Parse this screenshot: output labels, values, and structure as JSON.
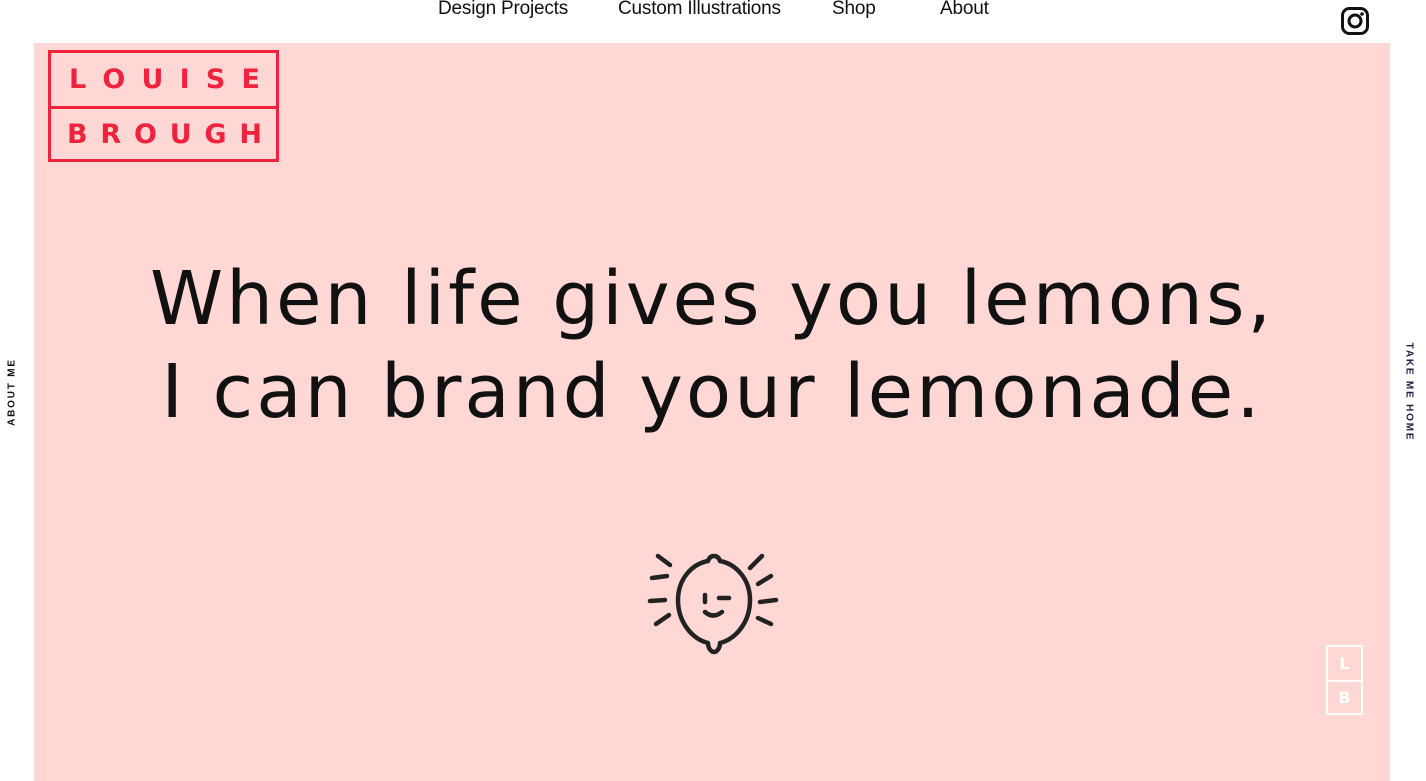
{
  "nav": {
    "items": [
      {
        "label": "Design Projects"
      },
      {
        "label": "Custom Illustrations"
      },
      {
        "label": "Shop"
      },
      {
        "label": "About"
      }
    ],
    "social_icon": "instagram-icon"
  },
  "side": {
    "left_label": "ABOUT ME",
    "right_label": "TAKE ME HOME"
  },
  "logo": {
    "line1": [
      "L",
      "O",
      "U",
      "I",
      "S",
      "E"
    ],
    "line2": [
      "B",
      "R",
      "O",
      "U",
      "G",
      "H"
    ]
  },
  "hero": {
    "line1": "When life gives you lemons,",
    "line2": "I can brand your lemonade.",
    "illustration": "winking-lemon-icon"
  },
  "mini_logo": {
    "top": "L",
    "bottom": "B"
  },
  "colors": {
    "hero_background": "#ffd8d6",
    "brand_red": "#f0233f",
    "text": "#111111"
  }
}
